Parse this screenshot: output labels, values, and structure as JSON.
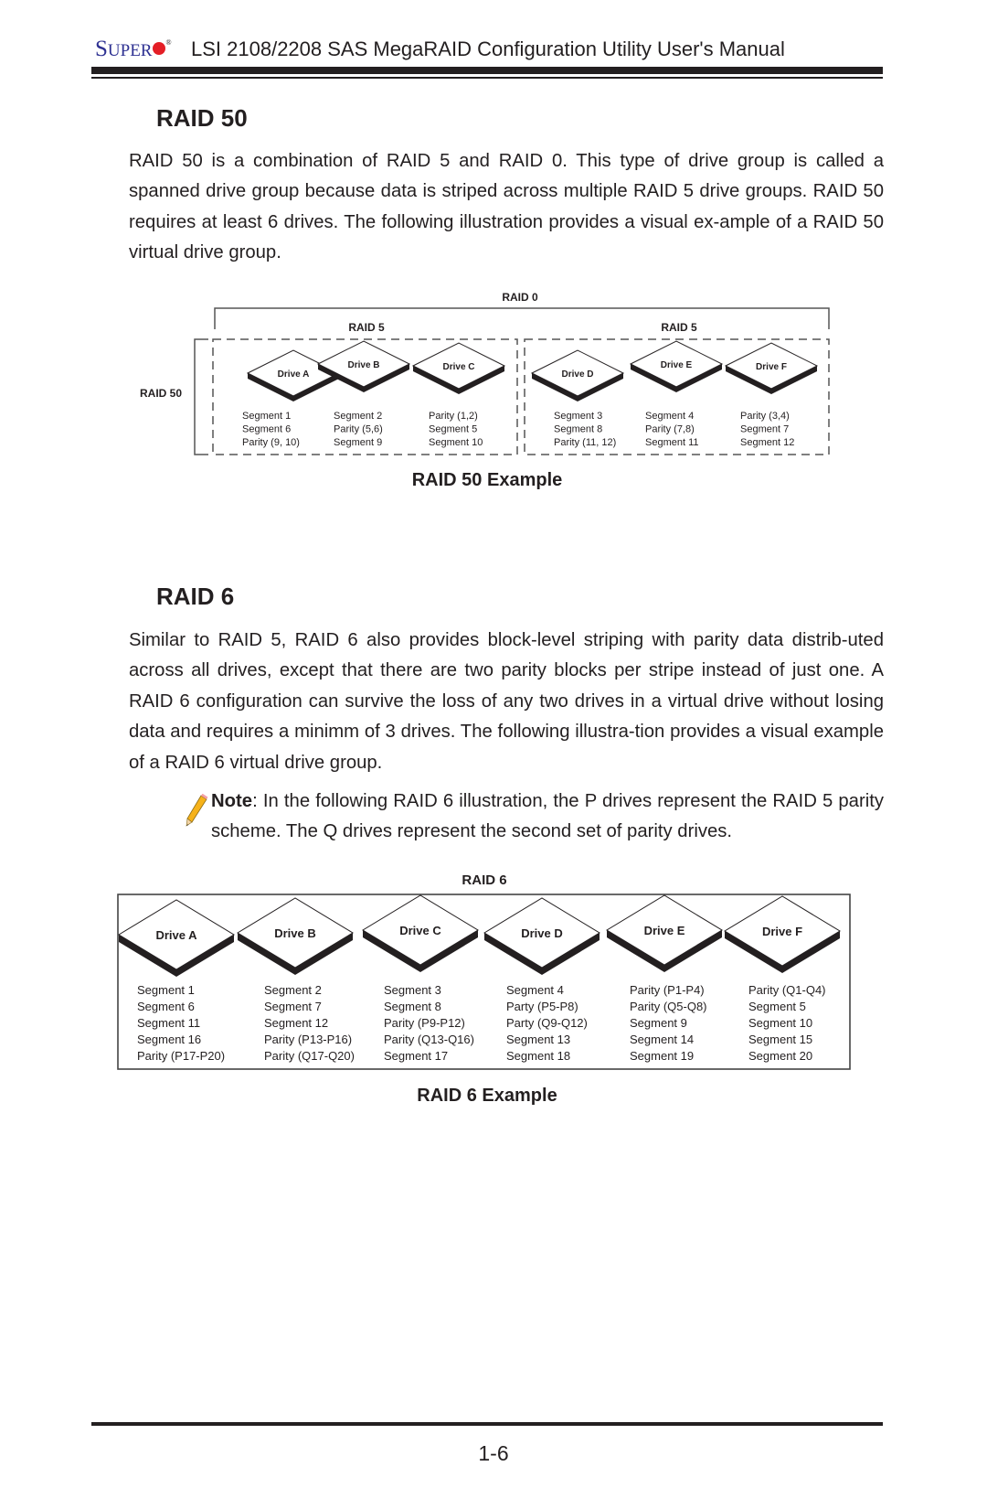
{
  "header": {
    "logo": {
      "main": "S",
      "rest": "UPER",
      "registered": "®"
    },
    "title": "LSI 2108/2208 SAS MegaRAID Configuration Utility User's Manual"
  },
  "raid50": {
    "heading": "RAID 50",
    "paragraph": "RAID 50 is a combination of RAID 5 and RAID 0. This type of drive group is called a spanned drive group because data is striped across multiple RAID 5 drive groups. RAID 50 requires at least 6 drives. The following illustration provides a visual ex-ample of a RAID 50 virtual drive group.",
    "diagram": {
      "top_label": "RAID 0",
      "side_label": "RAID 50",
      "groups": [
        {
          "label": "RAID 5",
          "drives": [
            {
              "name": "Drive A",
              "blocks": [
                "Segment 1",
                "Segment 6",
                "Parity (9, 10)"
              ]
            },
            {
              "name": "Drive B",
              "blocks": [
                "Segment 2",
                "Parity (5,6)",
                "Segment 9"
              ]
            },
            {
              "name": "Drive C",
              "blocks": [
                "Parity (1,2)",
                "Segment 5",
                "Segment 10"
              ]
            }
          ]
        },
        {
          "label": "RAID 5",
          "drives": [
            {
              "name": "Drive D",
              "blocks": [
                "Segment 3",
                "Segment 8",
                "Parity (11, 12)"
              ]
            },
            {
              "name": "Drive E",
              "blocks": [
                "Segment 4",
                "Parity (7,8)",
                "Segment 11"
              ]
            },
            {
              "name": "Drive F",
              "blocks": [
                "Parity (3,4)",
                "Segment 7",
                "Segment 12"
              ]
            }
          ]
        }
      ]
    },
    "caption": "RAID 50 Example"
  },
  "raid6": {
    "heading": "RAID 6",
    "paragraph": "Similar to RAID 5, RAID 6 also provides block-level striping with parity data distrib-uted across all drives, except that there are two parity blocks per stripe instead of just one. A RAID 6 configuration can survive the loss of any two drives in a virtual drive without losing data and requires a minimm of 3 drives. The following illustra-tion provides a visual example of a RAID 6 virtual drive group.",
    "note": {
      "icon": "pencil-icon",
      "label": "Note",
      "text": ": In the following RAID 6 illustration, the P drives represent the RAID 5 parity scheme. The Q drives represent the second set of parity drives."
    },
    "diagram": {
      "top_label": "RAID 6",
      "drives": [
        {
          "name": "Drive A",
          "blocks": [
            "Segment 1",
            "Segment 6",
            "Segment 11",
            "Segment 16",
            "Parity (P17-P20)"
          ]
        },
        {
          "name": "Drive B",
          "blocks": [
            "Segment 2",
            "Segment 7",
            "Segment 12",
            "Parity (P13-P16)",
            "Parity (Q17-Q20)"
          ]
        },
        {
          "name": "Drive C",
          "blocks": [
            "Segment 3",
            "Segment 8",
            "Parity (P9-P12)",
            "Parity (Q13-Q16)",
            "Segment 17"
          ]
        },
        {
          "name": "Drive D",
          "blocks": [
            "Segment 4",
            "Party (P5-P8)",
            "Party (Q9-Q12)",
            "Segment 13",
            "Segment 18"
          ]
        },
        {
          "name": "Drive E",
          "blocks": [
            "Parity (P1-P4)",
            "Parity (Q5-Q8)",
            "Segment 9",
            "Segment 14",
            "Segment 19"
          ]
        },
        {
          "name": "Drive F",
          "blocks": [
            "Parity (Q1-Q4)",
            "Segment 5",
            "Segment 10",
            "Segment 15",
            "Segment 20"
          ]
        }
      ]
    },
    "caption": "RAID 6 Example"
  },
  "footer": {
    "page_number": "1-6"
  }
}
